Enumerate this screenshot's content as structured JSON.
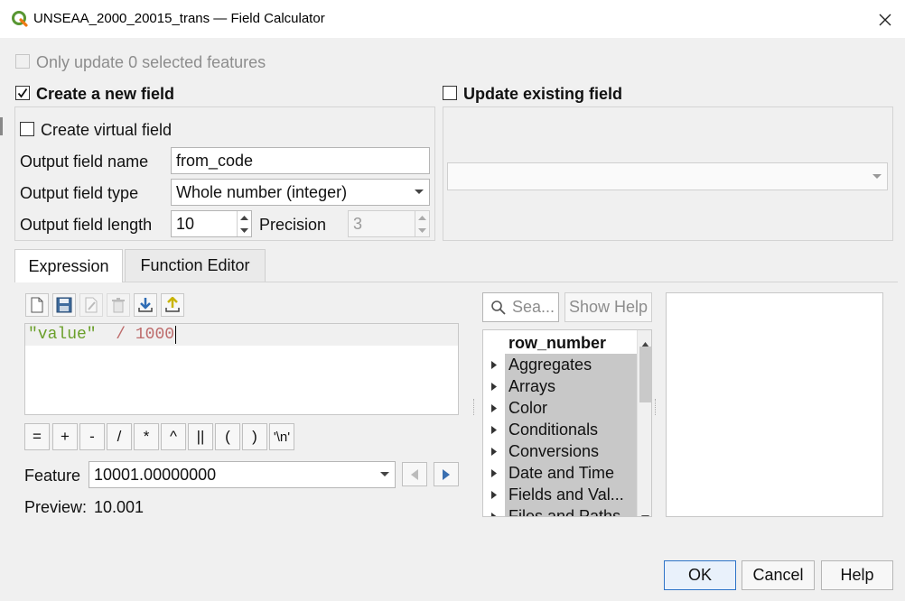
{
  "window": {
    "title": "UNSEAA_2000_20015_trans — Field Calculator",
    "close_icon": "close-icon",
    "logo_icon": "qgis-logo-icon"
  },
  "options": {
    "only_update_selected": "Only update 0 selected features",
    "create_new_field": "Create a new field",
    "create_new_field_checked": true,
    "update_existing_field": "Update existing field",
    "update_existing_field_checked": false,
    "create_virtual_field": "Create virtual field",
    "create_virtual_field_checked": false
  },
  "new_field": {
    "name_label": "Output field name",
    "name_value": "from_code",
    "type_label": "Output field type",
    "type_value": "Whole number (integer)",
    "length_label": "Output field length",
    "length_value": "10",
    "precision_label": "Precision",
    "precision_value": "3"
  },
  "existing_field": {
    "selected": ""
  },
  "tabs": [
    {
      "label": "Expression",
      "active": true
    },
    {
      "label": "Function Editor",
      "active": false
    }
  ],
  "toolbar": {
    "icons": [
      "new-file-icon",
      "save-icon",
      "edit-icon",
      "delete-icon",
      "import-icon",
      "export-icon"
    ]
  },
  "expression": {
    "field_token": "\"value\"",
    "operator_token": "/",
    "number_token": "1000"
  },
  "operators": [
    "=",
    "+",
    "-",
    "/",
    "*",
    "^",
    "||",
    "(",
    ")",
    "'\\n'"
  ],
  "feature": {
    "label": "Feature",
    "value": "10001.00000000",
    "prev_icon": "previous-arrow-icon",
    "next_icon": "next-arrow-icon"
  },
  "preview": {
    "label": "Preview:",
    "value": "10.001"
  },
  "function_list": {
    "search_placeholder": "Sea...",
    "show_help": "Show Help",
    "items": [
      {
        "label": "row_number",
        "group": false
      },
      {
        "label": "Aggregates",
        "group": true
      },
      {
        "label": "Arrays",
        "group": true
      },
      {
        "label": "Color",
        "group": true
      },
      {
        "label": "Conditionals",
        "group": true
      },
      {
        "label": "Conversions",
        "group": true
      },
      {
        "label": "Date and Time",
        "group": true
      },
      {
        "label": "Fields and Val...",
        "group": true
      },
      {
        "label": "Files and Paths",
        "group": true
      }
    ]
  },
  "buttons": {
    "ok": "OK",
    "cancel": "Cancel",
    "help": "Help"
  },
  "colors": {
    "field_token": "#6a9f2a",
    "operator_token": "#bd6b6b",
    "default_button_border": "#2e74c8"
  }
}
